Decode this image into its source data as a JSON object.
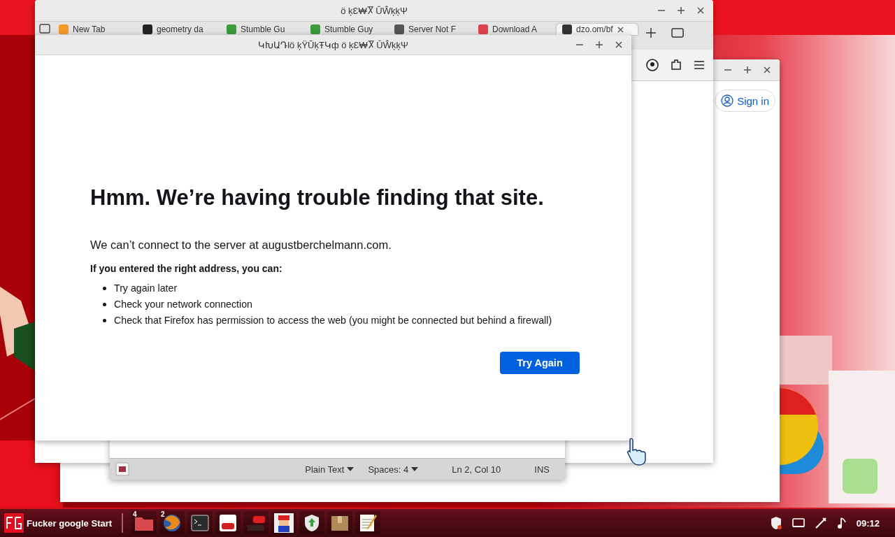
{
  "browser_window": {
    "title": "ö ķƐ₩Ⴟ ŬŴķķΨ",
    "tabs": [
      {
        "label": "New Tab",
        "selected": false
      },
      {
        "label": "geometry da",
        "selected": false
      },
      {
        "label": "Stumble Gu",
        "selected": false
      },
      {
        "label": "Stumble Guy",
        "selected": false
      },
      {
        "label": "Server Not F",
        "selected": false
      },
      {
        "label": "Download A",
        "selected": false
      },
      {
        "label": "dzo.om/bf",
        "selected": true
      }
    ]
  },
  "account_window": {
    "sign_in": "Sign in"
  },
  "editor_window": {
    "status_bar": {
      "language": "Plain Text",
      "spaces": "Spaces: 4",
      "position": "Ln 2, Col 10",
      "mode": "INS"
    }
  },
  "error_window": {
    "title": "ԿԽԱԴlö ķŸŪķŦԿф  ö ķƐ₩Ⴟ ŬŴķķΨ",
    "heading": "Hmm. We’re having trouble finding that site.",
    "message": "We can’t connect to the server at augustberchelmann.com.",
    "subheading": "If you entered the right address, you can:",
    "suggestions": [
      "Try again later",
      "Check your network connection",
      "Check that Firefox has permission to access the web (you might be connected but behind a firewall)"
    ],
    "button": "Try Again"
  },
  "taskbar": {
    "start_label": "Fucker google Start",
    "apps": [
      {
        "kind": "folder",
        "badge": "4"
      },
      {
        "kind": "browser",
        "badge": "2"
      },
      {
        "kind": "terminal"
      },
      {
        "kind": "video"
      },
      {
        "kind": "media"
      },
      {
        "kind": "game"
      },
      {
        "kind": "update"
      },
      {
        "kind": "package"
      },
      {
        "kind": "notes"
      }
    ],
    "clock": "09:12"
  }
}
